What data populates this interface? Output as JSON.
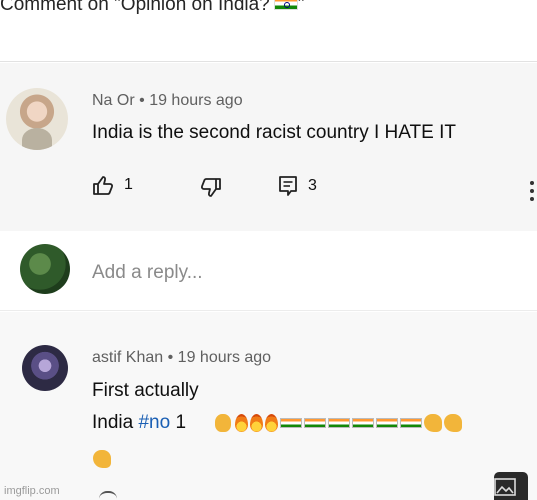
{
  "header": {
    "title": "Comment on \"Opinion on India?"
  },
  "comment": {
    "author": "Na Or",
    "separator": "•",
    "time": "19 hours ago",
    "text": "India is the second racist country I HATE IT",
    "likes": "1",
    "replies": "3",
    "icons": [
      "thumbs-up-icon",
      "thumbs-down-icon",
      "reply-icon",
      "more-vertical-icon"
    ]
  },
  "reply_box": {
    "placeholder": "Add a reply..."
  },
  "reply": {
    "author": "astif Khan",
    "separator": "•",
    "time": "19 hours ago",
    "line1": "First actually",
    "line2_prefix": "India ",
    "hashtag": "#no",
    "line2_suffix": " 1"
  },
  "watermark": "imgflip.com",
  "colors": {
    "hashtag": "#1a5fb4",
    "meta": "#606060",
    "background": "#f6f6f6"
  }
}
